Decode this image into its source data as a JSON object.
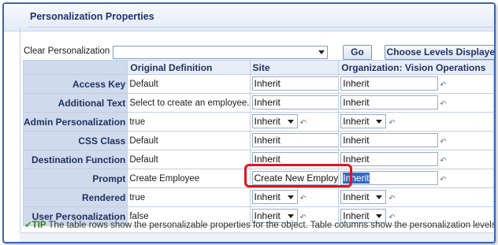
{
  "panel": {
    "title": "Personalization Properties"
  },
  "clear": {
    "label": "Clear Personalization",
    "value": ""
  },
  "buttons": {
    "go": "Go",
    "choose": "Choose Levels Displayed"
  },
  "columns": {
    "original": "Original Definition",
    "site": "Site",
    "org": "Organization: Vision Operations"
  },
  "rows": [
    {
      "label": "Access Key",
      "original": "Default",
      "site": "Inherit",
      "org": "Inherit",
      "kind": "text"
    },
    {
      "label": "Additional Text",
      "original": "Select to create an employee.",
      "site": "Inherit",
      "org": "Inherit",
      "kind": "text"
    },
    {
      "label": "Admin Personalization",
      "original": "true",
      "site": "Inherit",
      "org": "Inherit",
      "kind": "select"
    },
    {
      "label": "CSS Class",
      "original": "Default",
      "site": "Inherit",
      "org": "Inherit",
      "kind": "text"
    },
    {
      "label": "Destination Function",
      "original": "Default",
      "site": "Inherit",
      "org": "Inherit",
      "kind": "text"
    },
    {
      "label": "Prompt",
      "original": "Create Employee",
      "site": "Create New Employee",
      "org": "Inherit",
      "kind": "text"
    },
    {
      "label": "Rendered",
      "original": "true",
      "site": "Inherit",
      "org": "Inherit",
      "kind": "select"
    },
    {
      "label": "User Personalization",
      "original": "false",
      "site": "Inherit",
      "org": "Inherit",
      "kind": "select"
    }
  ],
  "tip": {
    "word": "TIP",
    "text": "The table rows show the personalizable properties for the object. Table columns show the personalization levels for ea"
  },
  "colors": {
    "highlight": "#e0141e",
    "selection": "#316ac5",
    "header_bg": "#cfdbed"
  },
  "icons": {
    "reset": "reset-icon",
    "tip": "checkmark-icon"
  }
}
